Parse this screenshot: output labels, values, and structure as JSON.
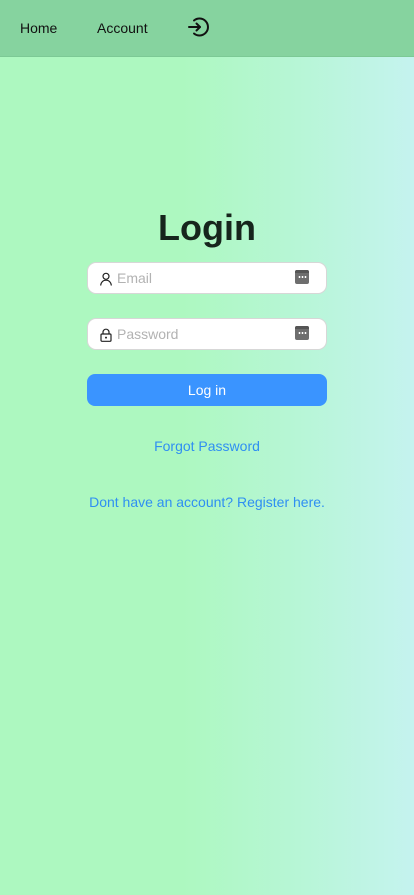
{
  "nav": {
    "home_label": "Home",
    "account_label": "Account",
    "logout_icon": "logout-icon"
  },
  "login": {
    "title": "Login",
    "email": {
      "placeholder": "Email",
      "value": "",
      "icon": "user-icon"
    },
    "password": {
      "placeholder": "Password",
      "value": "",
      "icon": "lock-icon"
    },
    "button_label": "Log in",
    "forgot_label": "Forgot Password",
    "register_label": "Dont have an account? Register here."
  },
  "colors": {
    "topbar": "#86d39f",
    "background_left": "#adf8c0",
    "background_right": "#c5f3ef",
    "button": "#3a94ff",
    "link": "#2f8ff2"
  }
}
